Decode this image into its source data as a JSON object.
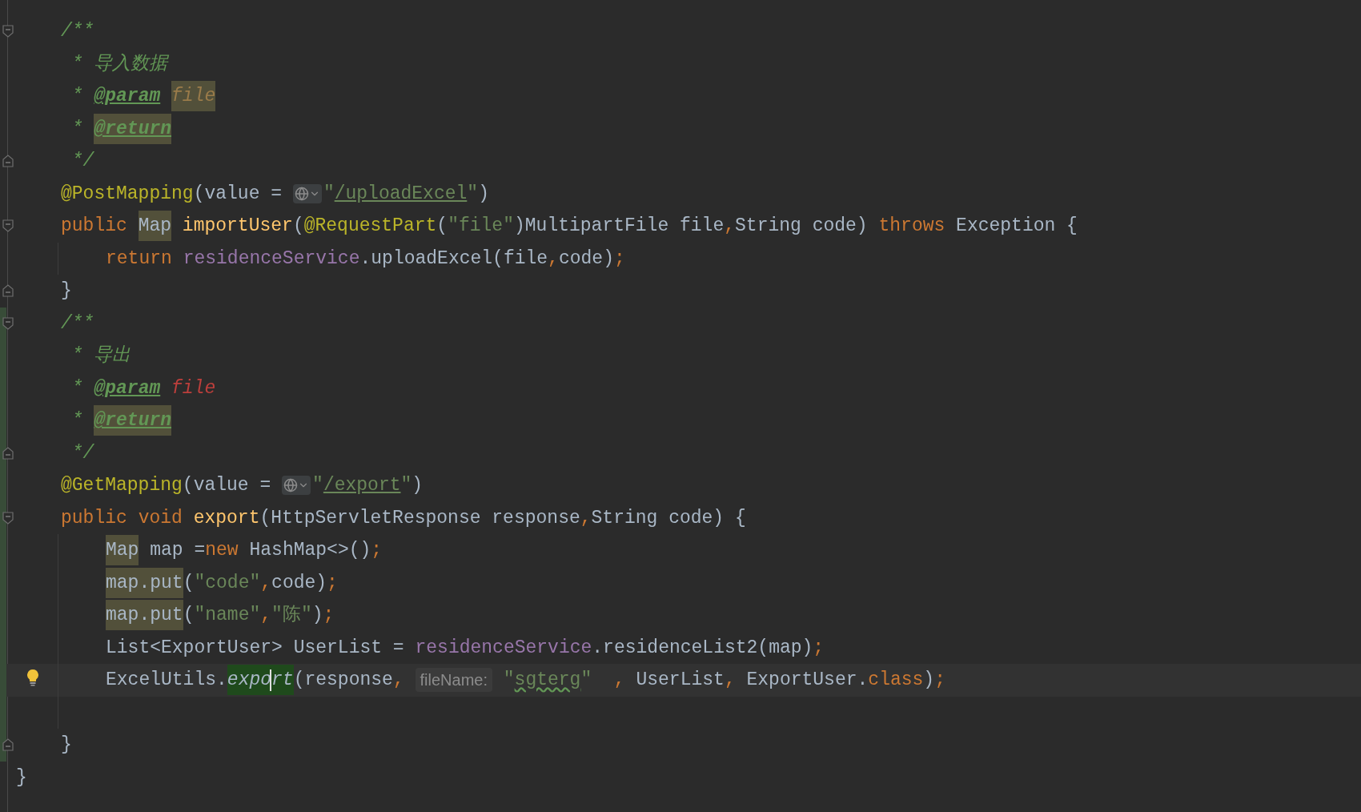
{
  "editor": {
    "lines": [
      {
        "fold_start": true,
        "changed": false,
        "tokens": [
          {
            "text": "/**",
            "kind": "comment"
          }
        ]
      },
      {
        "changed": false,
        "tokens": [
          {
            "text": " * 导入数据",
            "kind": "comment"
          }
        ]
      },
      {
        "changed": false,
        "tokens": [
          {
            "text": " * ",
            "kind": "comment"
          },
          {
            "text": "@param",
            "kind": "doctag"
          },
          {
            "text": "file",
            "kind": "docparam",
            "space_before": true,
            "highlighted": true
          }
        ]
      },
      {
        "changed": false,
        "tokens": [
          {
            "text": " * ",
            "kind": "comment"
          },
          {
            "text": "@return",
            "kind": "doctag",
            "highlighted": true
          }
        ]
      },
      {
        "fold_end": true,
        "changed": false,
        "tokens": [
          {
            "text": " */",
            "kind": "comment"
          }
        ]
      },
      {
        "changed": false,
        "tokens": [
          {
            "text": "@PostMapping",
            "kind": "annotation"
          },
          {
            "text": "(value = ",
            "kind": "text"
          },
          {
            "kind": "globe"
          },
          {
            "text": "\"",
            "kind": "string"
          },
          {
            "text": "/uploadExcel",
            "kind": "url"
          },
          {
            "text": "\"",
            "kind": "string"
          },
          {
            "text": ")",
            "kind": "text"
          }
        ]
      },
      {
        "fold_start": true,
        "changed": false,
        "tokens": [
          {
            "text": "public",
            "kind": "keyword"
          },
          {
            "text": "Map",
            "kind": "text",
            "space_before": true,
            "highlighted": true
          },
          {
            "text": "importUser",
            "kind": "method",
            "space_before": true
          },
          {
            "text": "(",
            "kind": "text"
          },
          {
            "text": "@RequestPart",
            "kind": "annotation"
          },
          {
            "text": "(",
            "kind": "text"
          },
          {
            "text": "\"file\"",
            "kind": "string"
          },
          {
            "text": ")MultipartFile file",
            "kind": "text"
          },
          {
            "text": ",",
            "kind": "keyword"
          },
          {
            "text": "String code) ",
            "kind": "text"
          },
          {
            "text": "throws",
            "kind": "keyword"
          },
          {
            "text": " Exception {",
            "kind": "text"
          }
        ],
        "children": [
          {
            "changed": false,
            "tokens": [
              {
                "text": "return",
                "kind": "keyword"
              },
              {
                "text": "residenceService",
                "kind": "field",
                "space_before": true
              },
              {
                "text": ".uploadExcel(file",
                "kind": "text"
              },
              {
                "text": ",",
                "kind": "keyword"
              },
              {
                "text": "code)",
                "kind": "text"
              },
              {
                "text": ";",
                "kind": "keyword"
              }
            ]
          }
        ]
      },
      {
        "fold_end": true,
        "changed": false,
        "tokens": [
          {
            "text": "}",
            "kind": "text"
          }
        ]
      },
      {
        "fold_start": true,
        "changed": true,
        "tokens": [
          {
            "text": "/**",
            "kind": "comment"
          }
        ]
      },
      {
        "changed": true,
        "tokens": [
          {
            "text": " * 导出",
            "kind": "comment"
          }
        ]
      },
      {
        "changed": true,
        "tokens": [
          {
            "text": " * ",
            "kind": "comment"
          },
          {
            "text": "@param",
            "kind": "doctag"
          },
          {
            "text": "file",
            "kind": "docerror",
            "space_before": true
          }
        ]
      },
      {
        "changed": true,
        "tokens": [
          {
            "text": " * ",
            "kind": "comment"
          },
          {
            "text": "@return",
            "kind": "doctag",
            "highlighted": true
          }
        ]
      },
      {
        "fold_end": true,
        "changed": true,
        "tokens": [
          {
            "text": " */",
            "kind": "comment"
          }
        ]
      },
      {
        "changed": true,
        "tokens": [
          {
            "text": "@GetMapping",
            "kind": "annotation"
          },
          {
            "text": "(value = ",
            "kind": "text"
          },
          {
            "kind": "globe"
          },
          {
            "text": "\"",
            "kind": "string"
          },
          {
            "text": "/export",
            "kind": "url"
          },
          {
            "text": "\"",
            "kind": "string"
          },
          {
            "text": ")",
            "kind": "text"
          }
        ]
      },
      {
        "fold_start": true,
        "changed": true,
        "tokens": [
          {
            "text": "public",
            "kind": "keyword"
          },
          {
            "text": "void",
            "kind": "keyword",
            "space_before": true
          },
          {
            "text": "export",
            "kind": "method",
            "space_before": true
          },
          {
            "text": "(HttpServletResponse response",
            "kind": "text"
          },
          {
            "text": ",",
            "kind": "keyword"
          },
          {
            "text": "String code) {",
            "kind": "text"
          }
        ],
        "children": [
          {
            "changed": true,
            "tokens": [
              {
                "text": "Map",
                "kind": "text",
                "highlighted": true
              },
              {
                "text": " map =",
                "kind": "text"
              },
              {
                "text": "new",
                "kind": "keyword"
              },
              {
                "text": " HashMap<>()",
                "kind": "text"
              },
              {
                "text": ";",
                "kind": "keyword"
              }
            ]
          },
          {
            "changed": true,
            "tokens": [
              {
                "text": "map.put",
                "kind": "text",
                "highlighted": true
              },
              {
                "text": "(",
                "kind": "text"
              },
              {
                "text": "\"code\"",
                "kind": "string"
              },
              {
                "text": ",",
                "kind": "keyword"
              },
              {
                "text": "code)",
                "kind": "text"
              },
              {
                "text": ";",
                "kind": "keyword"
              }
            ]
          },
          {
            "changed": true,
            "tokens": [
              {
                "text": "map.put",
                "kind": "text",
                "highlighted": true
              },
              {
                "text": "(",
                "kind": "text"
              },
              {
                "text": "\"name\"",
                "kind": "string"
              },
              {
                "text": ",",
                "kind": "keyword"
              },
              {
                "text": "\"陈\"",
                "kind": "string"
              },
              {
                "text": ")",
                "kind": "text"
              },
              {
                "text": ";",
                "kind": "keyword"
              }
            ]
          },
          {
            "changed": true,
            "tokens": [
              {
                "text": "List<ExportUser> UserList = ",
                "kind": "text"
              },
              {
                "text": "residenceService",
                "kind": "field"
              },
              {
                "text": ".residenceList2(map)",
                "kind": "text"
              },
              {
                "text": ";",
                "kind": "keyword"
              }
            ]
          },
          {
            "changed": true,
            "current": true,
            "bulb": true,
            "tokens": [
              {
                "text": "ExcelUtils.",
                "kind": "text"
              },
              {
                "text": "expo",
                "kind": "static",
                "focused": true,
                "caret": true
              },
              {
                "text": "rt",
                "kind": "static",
                "focused": true
              },
              {
                "text": "(response",
                "kind": "text"
              },
              {
                "text": ",",
                "kind": "keyword"
              },
              {
                "text": "fileName:",
                "kind": "hint",
                "space_before": true
              },
              {
                "text": "\"",
                "kind": "string",
                "space_before": true
              },
              {
                "text": "sgterg",
                "kind": "typo"
              },
              {
                "text": "\"  ",
                "kind": "string"
              },
              {
                "text": ",",
                "kind": "keyword"
              },
              {
                "text": " UserList",
                "kind": "text"
              },
              {
                "text": ",",
                "kind": "keyword"
              },
              {
                "text": " ExportUser.",
                "kind": "text"
              },
              {
                "text": "class",
                "kind": "keyword"
              },
              {
                "text": ")",
                "kind": "text"
              },
              {
                "text": ";",
                "kind": "keyword"
              }
            ]
          },
          {
            "changed": true
          }
        ]
      },
      {
        "fold_end": true,
        "changed": true,
        "tokens": [
          {
            "text": "}",
            "kind": "text"
          }
        ]
      }
    ],
    "class_end": {
      "changed": false,
      "tokens": [
        {
          "text": "}",
          "kind": "text"
        }
      ]
    }
  }
}
